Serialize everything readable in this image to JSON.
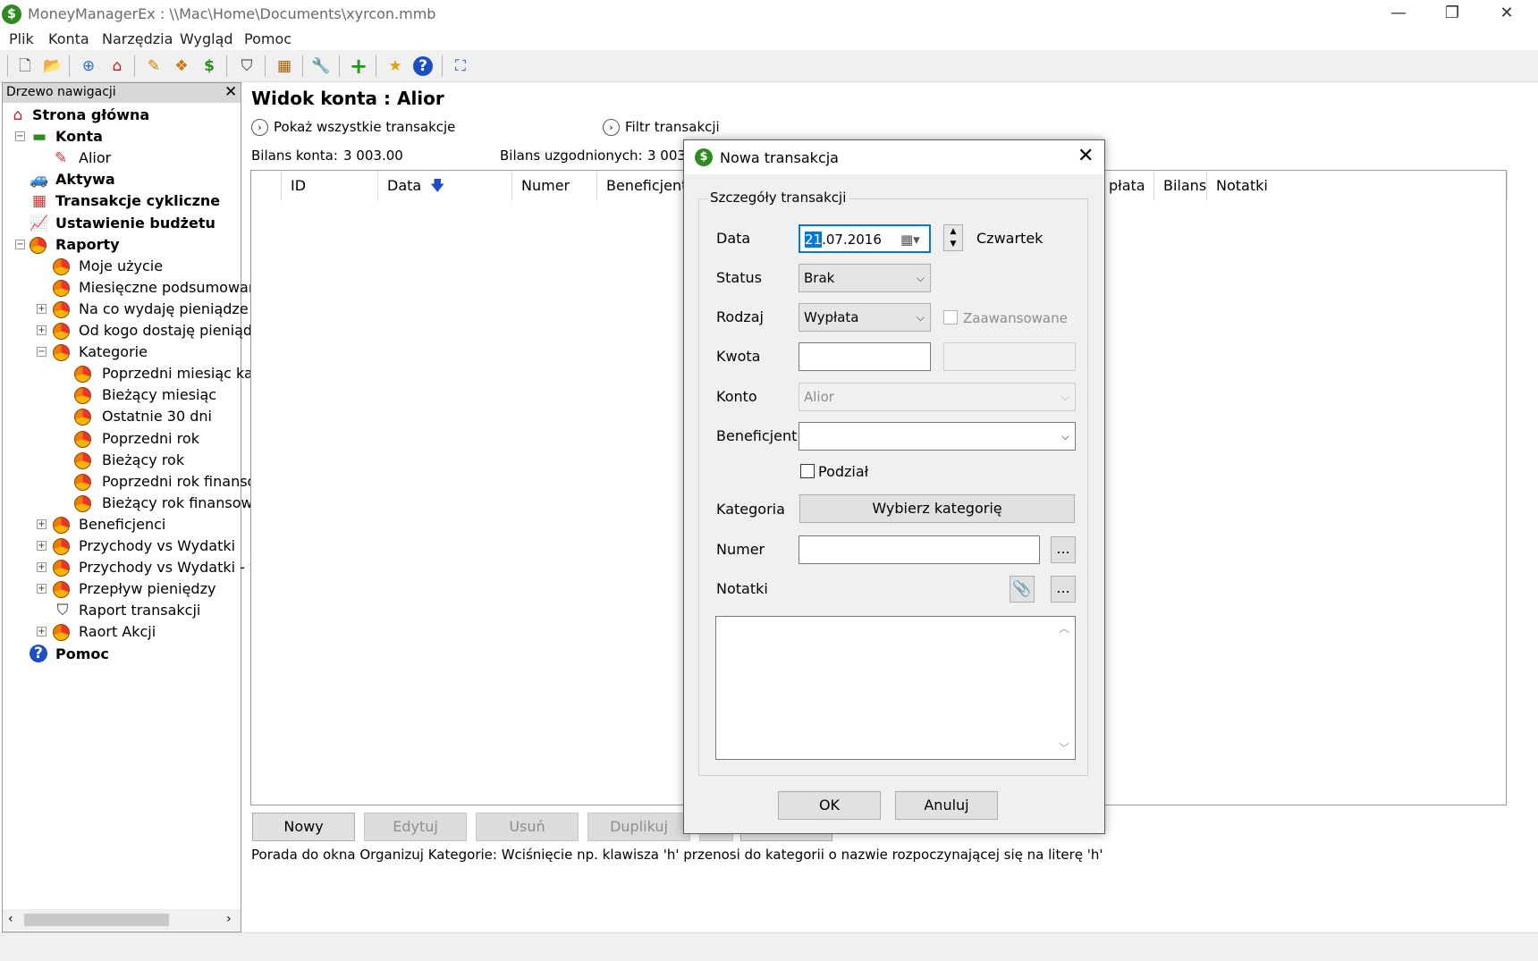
{
  "window": {
    "title": "MoneyManagerEx : \\\\Mac\\Home\\Documents\\xyrcon.mmb",
    "minimize": "—",
    "restore": "❐",
    "close": "✕"
  },
  "menu": [
    "Plik",
    "Konta",
    "Narzędzia",
    "Wygląd",
    "Pomoc"
  ],
  "toolbar": {
    "icons": [
      "new-file-icon",
      "open-folder-icon",
      "new-account-icon",
      "home-icon",
      "organize-payees-icon",
      "organize-categories-icon",
      "currency-icon",
      "transaction-filter-icon",
      "budget-icon",
      "options-icon",
      "new-transaction-icon",
      "favorites-icon",
      "help-icon",
      "fullscreen-icon"
    ]
  },
  "nav": {
    "header": "Drzewo nawigacji",
    "close": "✕",
    "items": [
      {
        "label": "Strona główna",
        "icon": "home-icon",
        "bold": true
      },
      {
        "label": "Konta",
        "icon": "accounts-icon",
        "bold": true
      },
      {
        "label": "Alior",
        "icon": "account-icon"
      },
      {
        "label": "Aktywa",
        "icon": "car-icon",
        "bold": true
      },
      {
        "label": "Transakcje cykliczne",
        "icon": "calendar-icon",
        "bold": true
      },
      {
        "label": "Ustawienie budżetu",
        "icon": "budget-chart-icon",
        "bold": true
      },
      {
        "label": "Raporty",
        "icon": "pie-chart-icon",
        "bold": true
      },
      {
        "label": "Moje użycie",
        "icon": "pie-chart-icon"
      },
      {
        "label": "Miesięczne podsumowan",
        "icon": "pie-chart-icon"
      },
      {
        "label": "Na co wydaję pieniądze",
        "icon": "pie-chart-icon"
      },
      {
        "label": "Od kogo dostaję pieniądz",
        "icon": "pie-chart-icon"
      },
      {
        "label": "Kategorie",
        "icon": "pie-chart-icon"
      },
      {
        "label": "Poprzedni miesiąc kal",
        "icon": "pie-chart-icon"
      },
      {
        "label": "Bieżący miesiąc",
        "icon": "pie-chart-icon"
      },
      {
        "label": "Ostatnie 30 dni",
        "icon": "pie-chart-icon"
      },
      {
        "label": "Poprzedni rok",
        "icon": "pie-chart-icon"
      },
      {
        "label": "Bieżący rok",
        "icon": "pie-chart-icon"
      },
      {
        "label": "Poprzedni rok finanso",
        "icon": "pie-chart-icon"
      },
      {
        "label": "Bieżący rok finansowy",
        "icon": "pie-chart-icon"
      },
      {
        "label": "Beneficjenci",
        "icon": "pie-chart-icon"
      },
      {
        "label": "Przychody vs Wydatki",
        "icon": "pie-chart-icon"
      },
      {
        "label": "Przychody vs Wydatki - w",
        "icon": "pie-chart-icon"
      },
      {
        "label": "Przepływ pieniędzy",
        "icon": "pie-chart-icon"
      },
      {
        "label": "Raport transakcji",
        "icon": "filter-icon"
      },
      {
        "label": "Raort Akcji",
        "icon": "pie-chart-icon"
      },
      {
        "label": "Pomoc",
        "icon": "help-icon",
        "bold": true
      }
    ]
  },
  "main": {
    "title": "Widok konta : Alior",
    "show_all": "Pokaż wszystkie transakcje",
    "filter": "Filtr transakcji",
    "balance_label": "Bilans konta:",
    "balance_value": "3 003.00",
    "reconciled_label": "Bilans uzgodnionych:",
    "reconciled_value": "3 003.",
    "columns": [
      "ID",
      "Data",
      "Numer",
      "Beneficjent",
      "płata",
      "Bilans",
      "Notatki"
    ],
    "sort_arrow": "🡇",
    "buttons": {
      "new": "Nowy",
      "edit": "Edytuj",
      "delete": "Usuń",
      "duplicate": "Duplikuj"
    },
    "tip": "Porada do okna Organizuj Kategorie: Wciśnięcie np. klawisza 'h' przenosi do kategorii o nazwie rozpoczynającej się na literę 'h'"
  },
  "dialog": {
    "title": "Nowa transakcja",
    "close": "✕",
    "group": "Szczegóły transakcji",
    "date_label": "Data",
    "date_selected": "21",
    "date_rest": ".07.2016",
    "weekday": "Czwartek",
    "status_label": "Status",
    "status_value": "Brak",
    "type_label": "Rodzaj",
    "type_value": "Wypłata",
    "advanced_label": "Zaawansowane",
    "amount_label": "Kwota",
    "amount_value": "",
    "account_label": "Konto",
    "account_value": "Alior",
    "payee_label": "Beneficjent",
    "payee_value": "",
    "split_label": "Podział",
    "category_label": "Kategoria",
    "category_button": "Wybierz kategorię",
    "number_label": "Numer",
    "number_value": "",
    "ellipsis": "...",
    "notes_label": "Notatki",
    "notes_value": "",
    "ok": "OK",
    "cancel": "Anuluj"
  }
}
